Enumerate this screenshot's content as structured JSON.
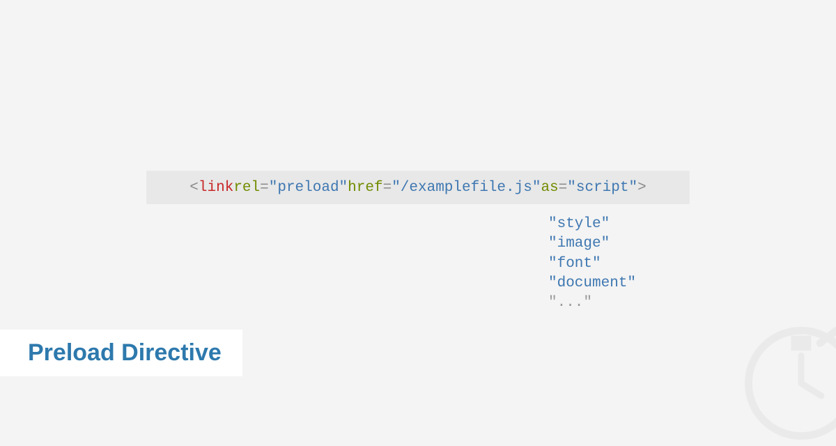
{
  "title": "Preload Directive",
  "code": {
    "open_angle": "<",
    "tag": "link",
    "space": " ",
    "attr_rel": "rel",
    "eq": "=",
    "val_rel": "\"preload\"",
    "attr_href": "href",
    "val_href": "\"/examplefile.js\"",
    "attr_as": "as",
    "val_as": "\"script\"",
    "close_angle": ">"
  },
  "options": [
    {
      "text": "\"style\"",
      "muted": false
    },
    {
      "text": "\"image\"",
      "muted": false
    },
    {
      "text": "\"font\"",
      "muted": false
    },
    {
      "text": "\"document\"",
      "muted": false
    },
    {
      "text": "\"...\"",
      "muted": true
    }
  ]
}
